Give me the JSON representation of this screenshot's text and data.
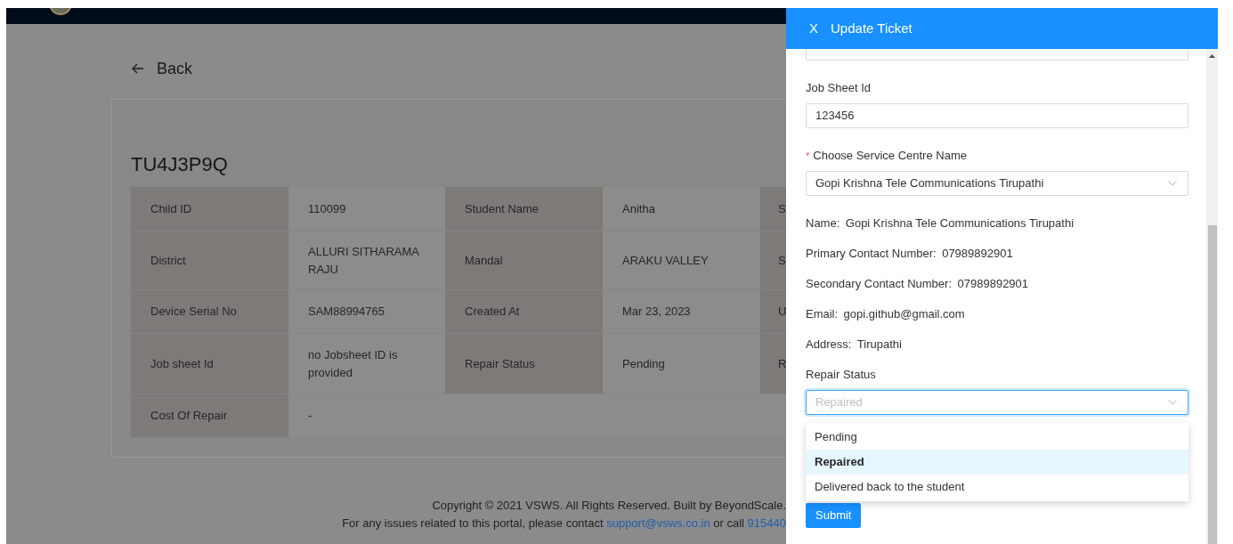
{
  "page": {
    "back_label": "Back"
  },
  "ticket": {
    "title": "TU4J3P9Q",
    "rows": [
      {
        "cells": [
          {
            "kind": "label",
            "text": "Child ID"
          },
          {
            "kind": "value",
            "text": "110099"
          },
          {
            "kind": "label",
            "text": "Student Name"
          },
          {
            "kind": "value",
            "text": "Anitha"
          },
          {
            "kind": "label",
            "text": "S"
          }
        ]
      },
      {
        "cells": [
          {
            "kind": "label",
            "text": "District"
          },
          {
            "kind": "value",
            "text": "ALLURI SITHARAMA RAJU"
          },
          {
            "kind": "label",
            "text": "Mandal"
          },
          {
            "kind": "value",
            "text": "ARAKU VALLEY"
          },
          {
            "kind": "label",
            "text": "S"
          }
        ]
      },
      {
        "cells": [
          {
            "kind": "label",
            "text": "Device Serial No"
          },
          {
            "kind": "value",
            "text": "SAM88994765"
          },
          {
            "kind": "label",
            "text": "Created At"
          },
          {
            "kind": "value",
            "text": "Mar 23, 2023"
          },
          {
            "kind": "label",
            "text": "U"
          }
        ]
      },
      {
        "cells": [
          {
            "kind": "label",
            "text": "Job sheet Id"
          },
          {
            "kind": "value",
            "text": "no Jobsheet ID is provided"
          },
          {
            "kind": "label",
            "text": "Repair Status"
          },
          {
            "kind": "value",
            "text": "Pending"
          },
          {
            "kind": "label",
            "text": "R"
          }
        ]
      },
      {
        "cells": [
          {
            "kind": "label",
            "text": "Cost Of Repair"
          },
          {
            "kind": "value",
            "text": "-",
            "wide": true
          }
        ]
      }
    ]
  },
  "footer": {
    "copyright": "Copyright © 2021 VSWS. All Rights Reserved. Built by BeyondScale.",
    "contact_text": "For any issues related to this portal, please contact ",
    "email": "support@vsws.co.in",
    "middle": " or call ",
    "phone": "915440"
  },
  "drawer": {
    "title": "Update Ticket",
    "close": "X",
    "fields": [
      {
        "kind": "cut_input"
      },
      {
        "kind": "text_input",
        "label": "Job Sheet Id",
        "value": "123456"
      },
      {
        "kind": "select",
        "label": "Choose Service Centre Name",
        "required_mark": "*",
        "value": "Gopi Krishna Tele Communications Tirupathi"
      }
    ],
    "details": [
      {
        "label": "Name:",
        "value": "Gopi Krishna Tele Communications Tirupathi"
      },
      {
        "label": "Primary Contact Number:",
        "value": "07989892901"
      },
      {
        "label": "Secondary Contact Number:",
        "value": "07989892901"
      },
      {
        "label": "Email:",
        "value": "gopi.github@gmail.com"
      },
      {
        "label": "Address:",
        "value": "Tirupathi"
      }
    ],
    "repair_status": {
      "label": "Repair Status",
      "placeholder": "Repaired",
      "open": true,
      "options": [
        {
          "label": "Pending",
          "selected": false
        },
        {
          "label": "Repaired",
          "selected": true
        },
        {
          "label": "Delivered back to the student",
          "selected": false
        }
      ]
    },
    "submit": "Submit"
  }
}
